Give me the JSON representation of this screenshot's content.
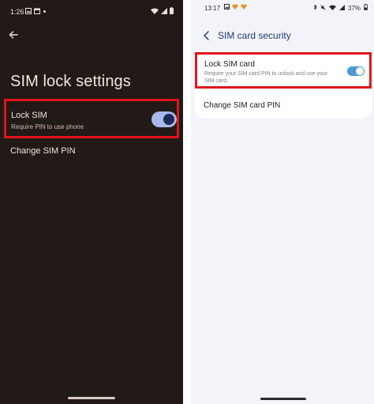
{
  "left_phone": {
    "status_bar": {
      "time": "1:26",
      "icons": [
        "image-icon",
        "calendar-icon",
        "dot-icon",
        "wifi-icon",
        "signal-icon",
        "battery-icon"
      ]
    },
    "back_icon": "arrow-left-icon",
    "title": "SIM lock settings",
    "lock_sim": {
      "title": "Lock SIM",
      "subtitle": "Require PIN to use phone",
      "enabled": true
    },
    "change_pin": {
      "label": "Change SIM PIN"
    },
    "colors": {
      "background": "#221a16",
      "toggle_track": "#a9b8e8",
      "toggle_knob": "#1d2a57",
      "highlight": "#e0141b"
    }
  },
  "right_phone": {
    "status_bar": {
      "time": "13:17",
      "battery": "37%",
      "icons": [
        "image-icon",
        "heart-icon",
        "heart-icon",
        "bluetooth-icon",
        "mute-icon",
        "wifi-icon",
        "signal-icon",
        "battery-icon"
      ]
    },
    "back_icon": "chevron-left-icon",
    "title": "SIM card security",
    "lock_sim": {
      "title": "Lock SIM card",
      "subtitle": "Require your SIM card PIN to unlock and use your SIM card.",
      "enabled": true
    },
    "change_pin": {
      "label": "Change SIM card PIN"
    },
    "colors": {
      "background": "#f3f4f9",
      "toggle_track": "#4a9bd6",
      "title": "#1f3a6e",
      "highlight": "#e0141b"
    }
  }
}
